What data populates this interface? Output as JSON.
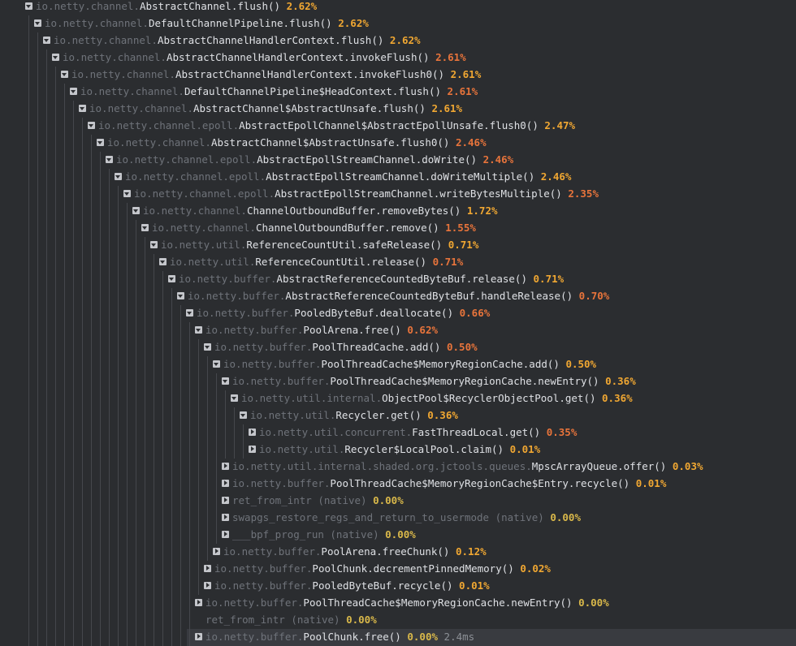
{
  "colors": {
    "high": "#e8743b",
    "mid": "#f0a732",
    "low": "#d9b84a"
  },
  "rows": [
    {
      "d": 0,
      "pkg": "io.netty.channel.",
      "cls": "AbstractChannel.flush()",
      "pct": "2.62%",
      "lvl": "mid"
    },
    {
      "d": 1,
      "pkg": "io.netty.channel.",
      "cls": "DefaultChannelPipeline.flush()",
      "pct": "2.62%",
      "lvl": "mid"
    },
    {
      "d": 2,
      "pkg": "io.netty.channel.",
      "cls": "AbstractChannelHandlerContext.flush()",
      "pct": "2.62%",
      "lvl": "mid"
    },
    {
      "d": 3,
      "pkg": "io.netty.channel.",
      "cls": "AbstractChannelHandlerContext.invokeFlush()",
      "pct": "2.61%",
      "lvl": "high"
    },
    {
      "d": 4,
      "pkg": "io.netty.channel.",
      "cls": "AbstractChannelHandlerContext.invokeFlush0()",
      "pct": "2.61%",
      "lvl": "mid"
    },
    {
      "d": 5,
      "pkg": "io.netty.channel.",
      "cls": "DefaultChannelPipeline$HeadContext.flush()",
      "pct": "2.61%",
      "lvl": "high"
    },
    {
      "d": 6,
      "pkg": "io.netty.channel.",
      "cls": "AbstractChannel$AbstractUnsafe.flush()",
      "pct": "2.61%",
      "lvl": "mid"
    },
    {
      "d": 7,
      "pkg": "io.netty.channel.epoll.",
      "cls": "AbstractEpollChannel$AbstractEpollUnsafe.flush0()",
      "pct": "2.47%",
      "lvl": "mid"
    },
    {
      "d": 8,
      "pkg": "io.netty.channel.",
      "cls": "AbstractChannel$AbstractUnsafe.flush0()",
      "pct": "2.46%",
      "lvl": "high"
    },
    {
      "d": 9,
      "pkg": "io.netty.channel.epoll.",
      "cls": "AbstractEpollStreamChannel.doWrite()",
      "pct": "2.46%",
      "lvl": "high"
    },
    {
      "d": 10,
      "pkg": "io.netty.channel.epoll.",
      "cls": "AbstractEpollStreamChannel.doWriteMultiple()",
      "pct": "2.46%",
      "lvl": "mid"
    },
    {
      "d": 11,
      "pkg": "io.netty.channel.epoll.",
      "cls": "AbstractEpollStreamChannel.writeBytesMultiple()",
      "pct": "2.35%",
      "lvl": "high"
    },
    {
      "d": 12,
      "pkg": "io.netty.channel.",
      "cls": "ChannelOutboundBuffer.removeBytes()",
      "pct": "1.72%",
      "lvl": "mid"
    },
    {
      "d": 13,
      "pkg": "io.netty.channel.",
      "cls": "ChannelOutboundBuffer.remove()",
      "pct": "1.55%",
      "lvl": "high"
    },
    {
      "d": 14,
      "pkg": "io.netty.util.",
      "cls": "ReferenceCountUtil.safeRelease()",
      "pct": "0.71%",
      "lvl": "mid"
    },
    {
      "d": 15,
      "pkg": "io.netty.util.",
      "cls": "ReferenceCountUtil.release()",
      "pct": "0.71%",
      "lvl": "high"
    },
    {
      "d": 16,
      "pkg": "io.netty.buffer.",
      "cls": "AbstractReferenceCountedByteBuf.release()",
      "pct": "0.71%",
      "lvl": "mid"
    },
    {
      "d": 17,
      "pkg": "io.netty.buffer.",
      "cls": "AbstractReferenceCountedByteBuf.handleRelease()",
      "pct": "0.70%",
      "lvl": "high"
    },
    {
      "d": 18,
      "pkg": "io.netty.buffer.",
      "cls": "PooledByteBuf.deallocate()",
      "pct": "0.66%",
      "lvl": "high"
    },
    {
      "d": 19,
      "pkg": "io.netty.buffer.",
      "cls": "PoolArena.free()",
      "pct": "0.62%",
      "lvl": "high"
    },
    {
      "d": 20,
      "pkg": "io.netty.buffer.",
      "cls": "PoolThreadCache.add()",
      "pct": "0.50%",
      "lvl": "high"
    },
    {
      "d": 21,
      "pkg": "io.netty.buffer.",
      "cls": "PoolThreadCache$MemoryRegionCache.add()",
      "pct": "0.50%",
      "lvl": "mid"
    },
    {
      "d": 22,
      "pkg": "io.netty.buffer.",
      "cls": "PoolThreadCache$MemoryRegionCache.newEntry()",
      "pct": "0.36%",
      "lvl": "mid"
    },
    {
      "d": 23,
      "pkg": "io.netty.util.internal.",
      "cls": "ObjectPool$RecyclerObjectPool.get()",
      "pct": "0.36%",
      "lvl": "mid"
    },
    {
      "d": 24,
      "pkg": "io.netty.util.",
      "cls": "Recycler.get()",
      "pct": "0.36%",
      "lvl": "mid"
    },
    {
      "d": 25,
      "pkg": "io.netty.util.concurrent.",
      "cls": "FastThreadLocal.get()",
      "pct": "0.35%",
      "lvl": "high",
      "c": true
    },
    {
      "d": 25,
      "pkg": "io.netty.util.",
      "cls": "Recycler$LocalPool.claim()",
      "pct": "0.01%",
      "lvl": "mid",
      "c": true
    },
    {
      "d": 22,
      "pkg": "io.netty.util.internal.shaded.org.jctools.queues.",
      "cls": "MpscArrayQueue.offer()",
      "pct": "0.03%",
      "lvl": "mid",
      "c": true
    },
    {
      "d": 22,
      "pkg": "io.netty.buffer.",
      "cls": "PoolThreadCache$MemoryRegionCache$Entry.recycle()",
      "pct": "0.01%",
      "lvl": "mid",
      "c": true
    },
    {
      "d": 22,
      "pkg": "ret_from_intr (native)",
      "cls": "",
      "pct": "0.00%",
      "lvl": "low",
      "c": true
    },
    {
      "d": 22,
      "pkg": "swapgs_restore_regs_and_return_to_usermode (native)",
      "cls": "",
      "pct": "0.00%",
      "lvl": "low",
      "c": true
    },
    {
      "d": 22,
      "pkg": "___bpf_prog_run (native)",
      "cls": "",
      "pct": "0.00%",
      "lvl": "low",
      "c": true
    },
    {
      "d": 21,
      "pkg": "io.netty.buffer.",
      "cls": "PoolArena.freeChunk()",
      "pct": "0.12%",
      "lvl": "mid",
      "c": true
    },
    {
      "d": 20,
      "pkg": "io.netty.buffer.",
      "cls": "PoolChunk.decrementPinnedMemory()",
      "pct": "0.02%",
      "lvl": "mid",
      "c": true
    },
    {
      "d": 20,
      "pkg": "io.netty.buffer.",
      "cls": "PooledByteBuf.recycle()",
      "pct": "0.01%",
      "lvl": "mid",
      "c": true
    },
    {
      "d": 19,
      "pkg": "io.netty.buffer.",
      "cls": "PoolThreadCache$MemoryRegionCache.newEntry()",
      "pct": "0.00%",
      "lvl": "low",
      "c": true
    },
    {
      "d": 19,
      "pkg": "ret_from_intr (native)",
      "cls": "",
      "pct": "0.00%",
      "lvl": "low",
      "leaf": true
    },
    {
      "d": 19,
      "pkg": "io.netty.buffer.",
      "cls": "PoolChunk.free()",
      "pct": "0.00%",
      "lvl": "low",
      "c": true,
      "time": "2.4ms",
      "hl": true
    }
  ]
}
